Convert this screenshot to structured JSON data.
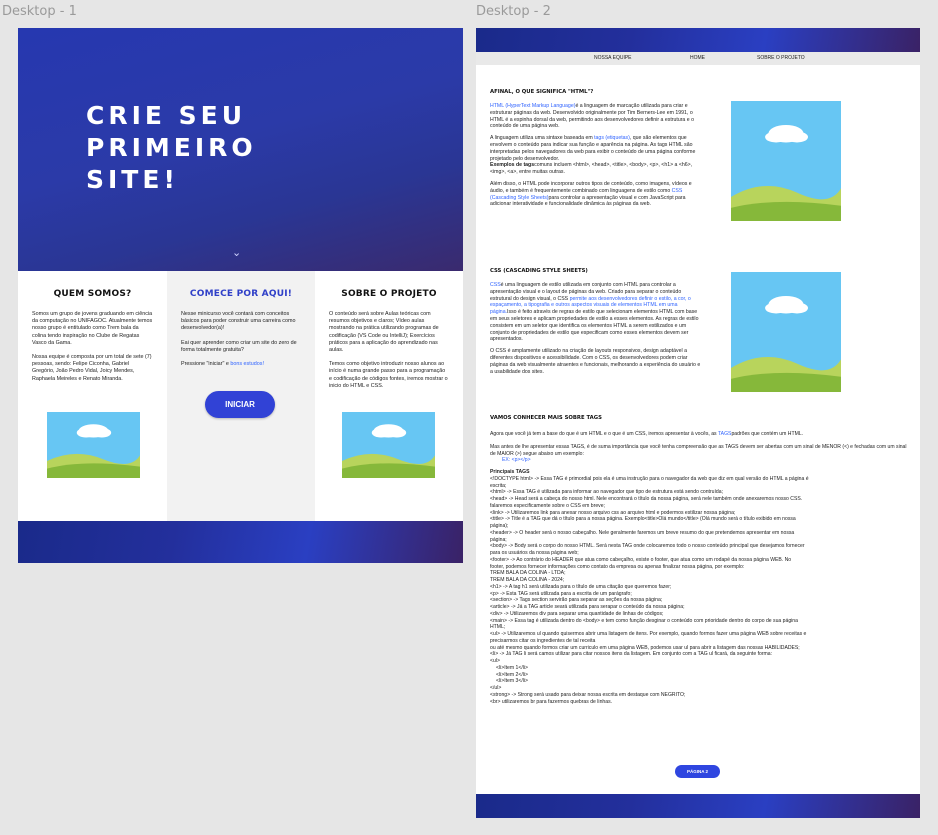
{
  "frames": {
    "desktop1": "Desktop - 1",
    "desktop2": "Desktop - 2"
  },
  "hero": {
    "title_lines": [
      "CRIE SEU",
      "PRIMEIRO",
      "SITE!"
    ],
    "chevron": "⌄"
  },
  "quem_somos": {
    "title": "QUEM SOMOS?",
    "p1": "Somos um grupo de jovens graduando em ciência da computação no UNIFAGOC. Atualmente temos nosso grupo é entitulado como Trem bala da colina tendo inspiração no Clube de Regatas Vasco da Gama.",
    "p2": "Nossa equipe é composta por um total de sete (7) pessoas, sendo: Felipe Ciconha, Gabriel Gregório, João Pedro Vidal, Joicy Mendes, Raphaela Meireles e Renato Miranda."
  },
  "comece": {
    "title": "COMECE POR AQUI!",
    "p1": "Nesse minicurso você contará com conceitos básicos para poder construir uma carreira como desenvolvedor(a)!",
    "p2": "Eai quer aprender como criar um site do zero de forma totalmente gratuita?",
    "p3_prefix": "Pressione \"iniciar\" e ",
    "p3_link": "bons estudos!",
    "button": "INICIAR"
  },
  "sobre": {
    "title": "SOBRE O PROJETO",
    "p1": "O conteúdo será sobre Aulas teóricas com resumos objetivos e claros; Vídeo aulas mostrando na prática utilizando programas de codificação (VS Code ou IntelliJ); Exercícios práticos para a aplicação do aprendizado nas aulas.",
    "p2": "Temos como objetivo introduzir nosso alunos ao início é numa grande passo para a programação e codificação de códigos fontes, iremos mostrar o inicio do HTML e CSS."
  },
  "nav": {
    "items": [
      "NOSSA EQUIPE",
      "HOME",
      "SOBRE O PROJETO"
    ]
  },
  "html_section": {
    "title": "AFINAL, O QUE SIGNIFICA \"HTML\"?",
    "p1_link": "HTML (HyperText Markup Language)",
    "p1": " é a linguagem de marcação utilizada para criar e estruturar páginas da web. Desenvolvido originalmente por Tim Berners-Lee em 1991, o HTML é a espinha dorsal da web, permitindo aos desenvolvedores definir a estrutura e o conteúdo de uma página web.",
    "p2_a": "A linguagem utiliza uma sintaxe baseada em ",
    "p2_link": "tags (etiquetas)",
    "p2_b": ", que são elementos que envolvem o conteúdo para indicar sua função e aparência na página. As tags HTML são interpretadas pelos navegadores da web para exibir o conteúdo de uma página conforme projetado pelo desenvolvedor.",
    "p2_bold": "Exemplos de tags",
    "p2_c": " comuns incluem <html>, <head>, <title>, <body>, <p>, <h1> a <h6>, <img>, <a>, entre muitas outras.",
    "p3_a": "Além disso, o HTML pode incorporar outros tipos de conteúdo, como imagens, vídeos e áudio, e também é frequentemente combinado com linguagens de estilo como ",
    "p3_link": "CSS (Cascading Style Sheets)",
    "p3_b": " para controlar a apresentação visual e com JavaScript para adicionar interatividade e funcionalidade dinâmica às páginas da web."
  },
  "css_section": {
    "title": "CSS (CASCADING STYLE SHEETS)",
    "p1_link": "CSS",
    "p1_a": " é uma linguagem de estilo utilizada em conjunto com HTML para controlar a apresentação visual e o layout de páginas da web. Criado para separar o conteúdo estrutural do design visual, o CSS ",
    "p1_link2": "permite aos desenvolvedores definir o estilo, a cor, o espaçamento, a tipografia e outros aspectos visuais de elementos HTML em uma página.",
    "p1_b": " Isso é feito através de regras de estilo que selecionam elementos HTML com base em seus seletores e aplicam propriedades de estilo a esses elementos. As regras de estilo consistem em um seletor que identifica os elementos HTML a serem estilizados e um conjunto de propriedades de estilo que especificam como esses elementos devem ser apresentados.",
    "p2": "O CSS é amplamente utilizado na criação de layouts responsivos, design adaptável a diferentes dispositivos e acessibilidade. Com o CSS, os desenvolvedores podem criar páginas da web visualmente atraentes e funcionais, melhorando a experiência do usuário e a usabilidade dos sites."
  },
  "tags_section": {
    "title": "VAMOS CONHECER MAIS SOBRE TAGS",
    "intro_a": "Agora que você já tem a base do que é um HTML e o que é um CSS, iremos apresentar à vocês, as ",
    "intro_link": "TAGS",
    "intro_b": " padrões que contém um HTML.",
    "p2": "Mas antes de lhe apresentar essas TAGS, é de suma importância que você tenha compreensão que as TAGS devem ser abertas com um sinal de MENOR (<) e fechadas com um sinal de MAIOR (>) segue abaixo um exemplo:",
    "example": "EX: <p></p>",
    "list_title": "Principais TAGS",
    "lines": [
      "<!DOCTYPE html> -> Essa TAG é primordial pois ela é uma instrução para o navegador da web que diz em qual versão do HTML a página é",
      "escrita;",
      "<html> -> Essa TAG é utilizada para informar ao navegador que tipo de estrutura está sendo contruída;",
      "<head> -> Head será a cabeça do nosso html. Nele encontrará o título da nossa página, será nele também onde anexaremos nosso CSS.",
      "falaremos especificamente sobre o CSS em breve;",
      "<link> -> Utilizaremos link para anexar nosso arquivo css ao arquivo html e podermos estilizar nossa página;",
      "<title> -> Title é a TAG que dá o título para a nossa página. Exemplo<title>Olá mundo</title> (Olá mundo será o título exibido em nossa",
      "página);",
      "<header> -> O header será o nosso cabeçalho. Nele geralmente faremos um breve resumo do que pretendemos apresentar em nossa",
      "página;",
      "<body> -> Body será o corpo do nosso HTML. Será nesta TAG onde colocaremos todo o nosso conteúdo principal que desejamos fornecer",
      "para os usuários da nossa página web;",
      "<footer> -> Ao contrário do HEADER que atua como cabeçalho, existe o footer, que atua como um rodapé da nossa página WEB. No",
      "footer, podemos fornecer informações como contato da empresa ou apenas finalizar nossa página, por exemplo:",
      "TREM BALA DA COLINA - LTDA;",
      "TREM BALA DA COLINA - 2024;",
      "<h1> -> A tag h1 será utilizada para o título de uma citação que queremos fazer;",
      "<p> -> Esta TAG será utilizada para a escrita de um parágrafo;",
      "<section> -> Tags section servirão para separar as seções da nossa página;",
      "<article> -> Já a TAG article seará utilizada para serapar o conteúdo da nossa página;",
      "<div> -> Utilizaremos div para separar uma quantidade de linhas de códigos;",
      "<main> -> Essa tag é utilizada dentro do <body> e tem como função desginar o conteúdo com prioridade dentro do corpo de sua página",
      "HTML;",
      "<ul> -> Utilizaremos ul quando quisermos abrir uma listagem de itens. Por exemplo, quando formos fazer uma página WEB sobre receitas e",
      "precisarmos citar os ingredientes de tal receita",
      "ou até mesmo quando formos criar um curriculo em uma página WEB, podemos usar ul para abrir a listagem das nossas HABILIDADES;",
      "<li> -> Já TAG li será camos utilizar para citar nossos itens da listagem. Em conjunto com a TAG ul ficará, da seguinte forma:",
      "<ul>",
      "  <li>Item 1</li>",
      "  <li>Item 2</li>",
      "  <li>Item 3</li>",
      "</ul>",
      "<strong> -> Strong será usado para deixar nossa escrita em destaque com NEGRITO;",
      "<br> utilizaremos br para fazermos quebras de linhas."
    ],
    "button": "PÁGINA 2"
  }
}
